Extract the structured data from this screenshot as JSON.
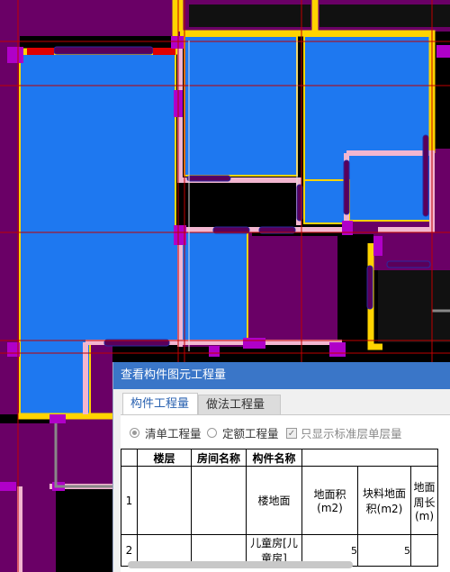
{
  "dialog": {
    "title": "查看构件图元工程量",
    "tabs": [
      {
        "label": "构件工程量",
        "active": true
      },
      {
        "label": "做法工程量",
        "active": false
      }
    ],
    "options": {
      "radio_bill": "清单工程量",
      "radio_quota": "定额工程量",
      "checkbox_std_floor": "只显示标准层单层量",
      "selected": "清单工程量",
      "checkbox_checked": true
    },
    "table": {
      "headers": [
        "楼层",
        "房间名称",
        "构件名称"
      ],
      "row1": {
        "index": "1",
        "component": "楼地面",
        "col_area": "地面积(m2)",
        "col_block_area": "块料地面积(m2)",
        "col_perimeter": "地面周长(m)"
      },
      "row2": {
        "index": "2",
        "component": "儿童房[儿童房]",
        "area": "5",
        "block_area": "5"
      }
    }
  },
  "colors": {
    "room_fill": "#1e78f0",
    "wall_fill": "#6a0066",
    "wall_outline": "#ffd400",
    "column": "#b000c8",
    "grid_line": "#c00000",
    "dialog_title": "#3a76c8"
  }
}
